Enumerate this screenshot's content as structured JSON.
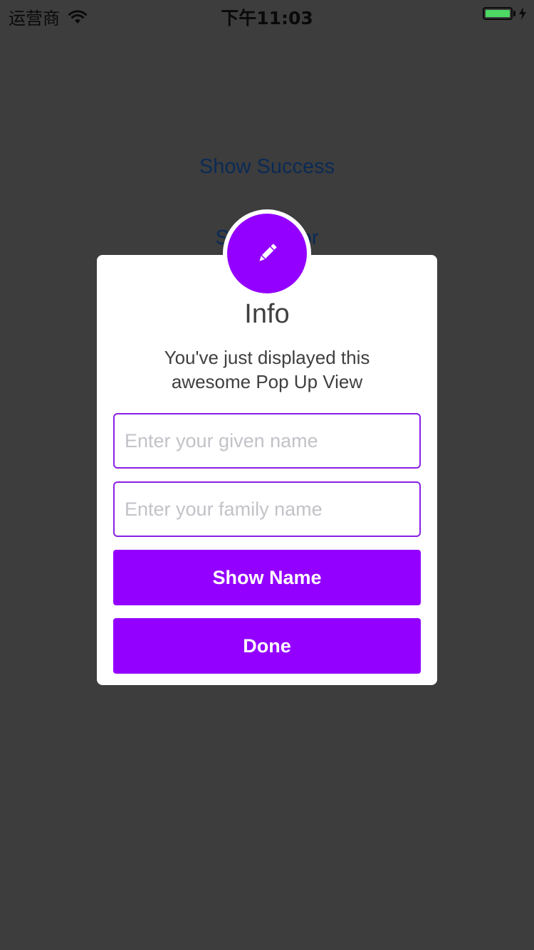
{
  "status_bar": {
    "carrier": "运营商",
    "time": "下午11:03",
    "battery_level": 1.0,
    "battery_color": "#4cd964",
    "icons": [
      "wifi-icon",
      "battery-icon",
      "charging-bolt-icon"
    ]
  },
  "background": {
    "color": "#3d3d3d",
    "link_color": "#0b2a55",
    "links": [
      {
        "label": "Show Success"
      },
      {
        "label": "Show Error"
      }
    ]
  },
  "popup": {
    "badge_icon": "pencil-icon",
    "accent_color": "#9400ff",
    "title": "Info",
    "message_line1": "You've just displayed this",
    "message_line2": "awesome Pop Up View",
    "given_name_placeholder": "Enter your given name",
    "family_name_placeholder": "Enter your family name",
    "show_name_label": "Show Name",
    "done_label": "Done"
  }
}
